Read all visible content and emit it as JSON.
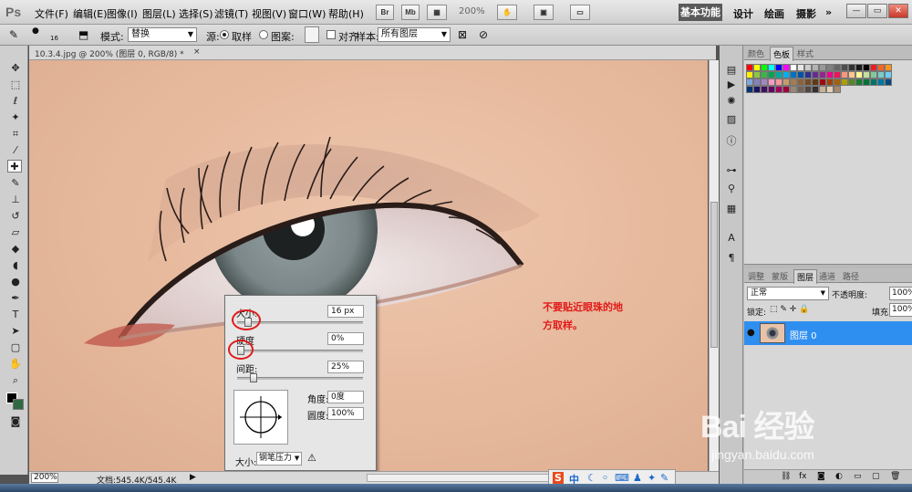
{
  "app": {
    "logo": "Ps"
  },
  "menu": [
    "文件(F)",
    "编辑(E)",
    "图像(I)",
    "图层(L)",
    "选择(S)",
    "滤镜(T)",
    "视图(V)",
    "窗口(W)",
    "帮助(H)"
  ],
  "menubar_buttons": {
    "br": "Br",
    "mb": "Mb"
  },
  "zoom": "200%",
  "workspaces": [
    "基本功能",
    "设计",
    "绘画",
    "摄影"
  ],
  "workspace_more": "»",
  "window_controls": {
    "minimize": "—",
    "restore": "▭",
    "close": "✕"
  },
  "options": {
    "brush_size": "16",
    "mode_label": "模式:",
    "mode_value": "替换",
    "source_label": "源:",
    "sampled_label": "取样",
    "pattern_label": "图案:",
    "aligned_label": "对齐",
    "sample_label": "样本:",
    "sample_value": "所有图层"
  },
  "document": {
    "tab_title": "10.3.4.jpg @ 200% (图层 0, RGB/8) *",
    "close": "×"
  },
  "status": {
    "zoom": "200%",
    "doc_info": "文档:545.4K/545.4K"
  },
  "annotation": "不要贴近眼珠的地方取样。",
  "brush_popup": {
    "size_label": "大小:",
    "size_value": "16 px",
    "size_fraction": 0.06,
    "hardness_label": "硬度",
    "hardness_value": "0%",
    "hardness_fraction": 0.0,
    "spacing_label": "间距:",
    "spacing_value": "25%",
    "spacing_fraction": 0.1,
    "angle_label": "角度:",
    "angle_value": "0度",
    "roundness_label": "圆度:",
    "roundness_value": "100%",
    "size_mode_label": "大小:",
    "size_mode_value": "钢笔压力",
    "warning_icon": "warning-icon"
  },
  "panels": {
    "color_tabs": [
      "颜色",
      "色板",
      "样式"
    ],
    "layer_tabs": [
      "调整",
      "蒙版",
      "图层",
      "通道",
      "路径"
    ],
    "blend_mode": "正常",
    "opacity_label": "不透明度:",
    "opacity_value": "100%",
    "lock_label": "锁定:",
    "lock_icons": "⬚ ✎ ✛ 🔒",
    "fill_label": "填充:",
    "fill_value": "100%",
    "layer_name": "图层 0",
    "layer_eye": "●"
  },
  "tray": {
    "ime": "S",
    "lang": "中"
  },
  "watermark": {
    "brand": "Bai 经验",
    "url": "jingyan.baidu.com"
  },
  "colors": {
    "annotation": "#e21a1a",
    "highlight": "#2f8ff0",
    "marker": "#e11b1b"
  }
}
